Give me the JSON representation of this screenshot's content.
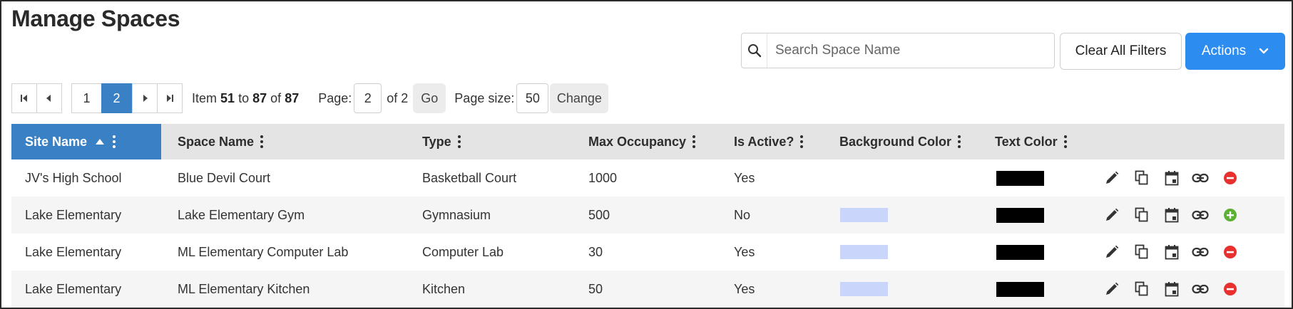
{
  "page": {
    "title": "Manage Spaces"
  },
  "toolbar": {
    "search_placeholder": "Search Space Name",
    "search_value": "",
    "search_icon": "search-icon",
    "clear_label": "Clear All Filters",
    "actions_label": "Actions",
    "actions_icon": "chevron-down-icon"
  },
  "colors": {
    "accent": "#2d8cf0",
    "header_sorted": "#3a80c4",
    "active_page": "#3a80c4",
    "header_bg": "#e4e4e4",
    "row_alt": "#f5f5f5",
    "deactivate": "#e8302e",
    "activate": "#5cb133"
  },
  "pager": {
    "pages": [
      "1",
      "2"
    ],
    "current_page": "2",
    "item_label": "Item",
    "item_start": "51",
    "to_label": "to",
    "item_end": "87",
    "of_label": "of",
    "item_total": "87",
    "page_label": "Page:",
    "page_value": "2",
    "of_pages": "of 2",
    "go_label": "Go",
    "page_size_label": "Page size:",
    "page_size_value": "50",
    "change_label": "Change"
  },
  "table": {
    "columns": [
      {
        "label": "Site Name",
        "sorted": "asc"
      },
      {
        "label": "Space Name"
      },
      {
        "label": "Type"
      },
      {
        "label": "Max Occupancy"
      },
      {
        "label": "Is Active?"
      },
      {
        "label": "Background Color"
      },
      {
        "label": "Text Color"
      }
    ],
    "rows": [
      {
        "site": "JV's High School",
        "space": "Blue Devil Court",
        "type": "Basketball Court",
        "max": "1000",
        "active": "Yes",
        "bg_color": "",
        "text_color": "#000000",
        "toggle": "deactivate"
      },
      {
        "site": "Lake Elementary",
        "space": "Lake Elementary Gym",
        "type": "Gymnasium",
        "max": "500",
        "active": "No",
        "bg_color": "#c9d5fb",
        "text_color": "#000000",
        "toggle": "activate"
      },
      {
        "site": "Lake Elementary",
        "space": "ML Elementary Computer Lab",
        "type": "Computer Lab",
        "max": "30",
        "active": "Yes",
        "bg_color": "#c9d5fb",
        "text_color": "#000000",
        "toggle": "deactivate"
      },
      {
        "site": "Lake Elementary",
        "space": "ML Elementary Kitchen",
        "type": "Kitchen",
        "max": "50",
        "active": "Yes",
        "bg_color": "#c9d5fb",
        "text_color": "#000000",
        "toggle": "deactivate"
      }
    ],
    "row_actions": [
      "edit-icon",
      "copy-icon",
      "calendar-icon",
      "link-icon"
    ]
  }
}
